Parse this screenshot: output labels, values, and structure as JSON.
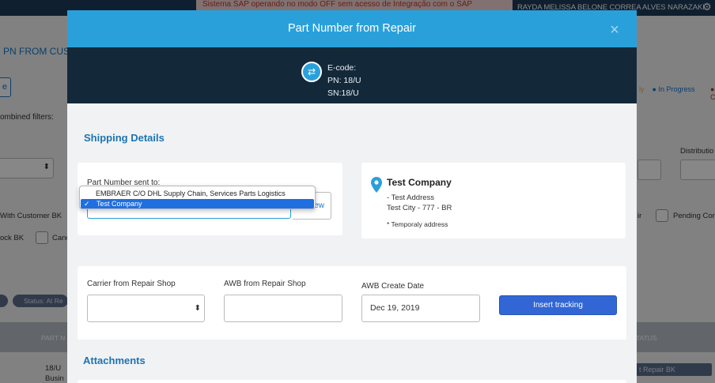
{
  "background": {
    "sap_notice": "Sistema SAP operando no modo OFF sem acesso de Integração com o SAP",
    "user_name": "RAYDA MELISSA BELONE CORREA ALVES NARAZAKI",
    "page_title_fragment": "PN FROM CUST",
    "button_fragment": "e",
    "combined_filters": "ombined filters:",
    "legend_in_progress": "In Progress",
    "legend_fragment_left": "ly",
    "legend_fragment_right": "C",
    "distribution_fragment": "Distributio",
    "with_customer_bk": "With Customer BK",
    "stock_bk": "ock BK",
    "canc_fragment": "Canc",
    "ir_fragment": "ir",
    "pending_fragment": "Pending Cor",
    "status_pill": "Status: At Re",
    "col_part_fragment": "PART N",
    "col_status_fragment": "TATUS",
    "row_pn": "18/U",
    "row_busi": "Busin",
    "row_repair_bk": "t Repair BK"
  },
  "modal": {
    "title": "Part Number from Repair",
    "close_glyph": "×",
    "ecode": {
      "label": "E-code:",
      "pn": "PN: 18/U",
      "sn": "SN:18/U"
    },
    "shipping_title": "Shipping Details",
    "part_number_label": "Part Number sent to:",
    "new_button": "New",
    "dropdown_options": [
      {
        "label": "EMBRAER C/O DHL Supply Chain, Services Parts Logistics",
        "selected": false
      },
      {
        "label": "Test Company",
        "selected": true
      }
    ],
    "address": {
      "name": "Test Company",
      "line1": "- Test Address",
      "line2": "Test City - 777 - BR",
      "note": "* Temporaly address"
    },
    "carrier_label": "Carrier from Repair Shop",
    "carrier_value": "",
    "awb_label": "AWB from Repair Shop",
    "awb_value": "",
    "awb_date_label": "AWB Create Date",
    "awb_date_value": "Dec 19, 2019",
    "insert_button": "Insert tracking",
    "attachments_title": "Attachments"
  }
}
